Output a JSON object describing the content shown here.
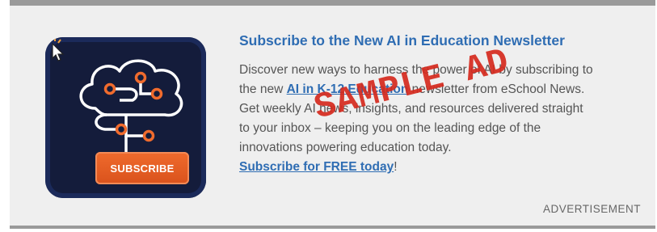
{
  "ad": {
    "headline": "Subscribe to the New AI in Education Newsletter",
    "body_lines": [
      "Discover new ways to harness the power of AI by subscribing to",
      "the new ",
      " newsletter from eSchool News.",
      "Get weekly AI news, insights, and resources delivered straight",
      "to your inbox – keeping you on the leading edge of the",
      "innovations powering education today."
    ],
    "newsletter_link": "AI in K-12 Education",
    "cta_link": "Subscribe for FREE today",
    "cta_suffix": "!",
    "stamp_text": "SAMPLE AD",
    "advertisement_label": "ADVERTISEMENT"
  },
  "tile": {
    "button_label": "SUBSCRIBE",
    "icons": [
      "brain-circuit-icon",
      "cursor-click-icon"
    ]
  },
  "colors": {
    "frame_bg": "#efefef",
    "frame_border": "#9a9a9a",
    "link": "#2f6db3",
    "body_text": "#555555",
    "tile_bg": "#141c3b",
    "accent_orange": "#f06b2d",
    "stamp_red": "#d52a1e"
  }
}
